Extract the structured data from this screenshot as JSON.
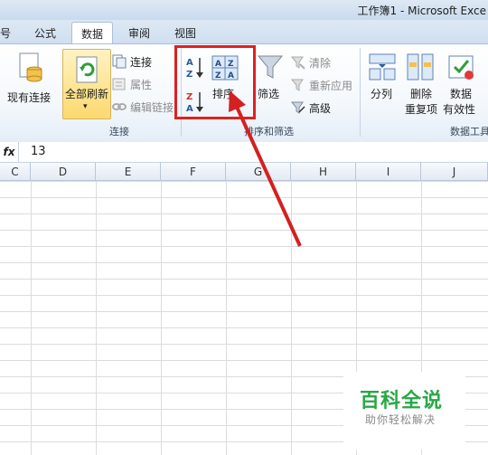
{
  "window": {
    "title": "工作簿1 - Microsoft Exce"
  },
  "tabs": [
    {
      "label": "号"
    },
    {
      "label": "公式"
    },
    {
      "label": "数据"
    },
    {
      "label": "审阅"
    },
    {
      "label": "视图"
    }
  ],
  "ribbon": {
    "existing_connections": "现有连接",
    "refresh_all": "全部刷新",
    "connections": "连接",
    "properties": "属性",
    "edit_links": "编辑链接",
    "group_connections": "连接",
    "sort_az": "A↓Z",
    "sort_za": "Z↓A",
    "sort": "排序",
    "filter": "筛选",
    "clear": "清除",
    "reapply": "重新应用",
    "advanced": "高级",
    "group_sort_filter": "排序和筛选",
    "text_to_columns": "分列",
    "remove_dup_1": "删除",
    "remove_dup_2": "重复项",
    "data_valid_1": "数据",
    "data_valid_2": "有效性",
    "group_data_tools": "数据工具"
  },
  "formula_bar": {
    "fx": "fx",
    "value": "13"
  },
  "columns": [
    "C",
    "D",
    "E",
    "F",
    "G",
    "H",
    "I",
    "J"
  ],
  "watermark": {
    "title": "百科全说",
    "subtitle": "助你轻松解决"
  },
  "colors": {
    "highlight": "#e02020",
    "accent": "#27a844"
  }
}
